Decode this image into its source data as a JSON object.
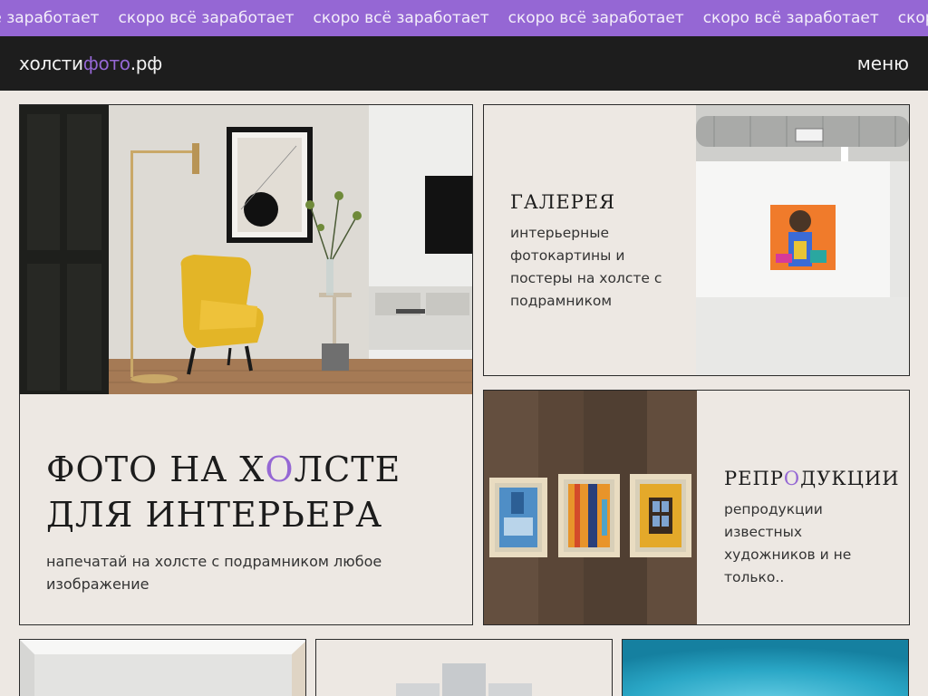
{
  "ticker": {
    "text": "скоро всё заработает",
    "first_fragment": "всё заработает"
  },
  "header": {
    "logo_part1": "холсти",
    "logo_part2": "фото",
    "logo_part3": ".рф",
    "menu_label": "меню"
  },
  "hero": {
    "title_line1_a": "ФОТО НА Х",
    "title_line1_o": "О",
    "title_line1_b": "ЛСТЕ",
    "title_line2": "ДЛЯ ИНТЕРЬЕРА",
    "subtitle": "напечатай на холсте с подрамником любое изображение"
  },
  "gallery": {
    "title": "ГАЛЕРЕЯ",
    "description": "интерьерные фотокартины и постеры на холсте с подрамником"
  },
  "repro": {
    "title_a": "РЕПР",
    "title_o": "О",
    "title_b": "ДУКЦИИ",
    "description": "репродукции известных художников и не только.."
  },
  "colors": {
    "accent": "#9567d4",
    "background": "#ede8e3",
    "header": "#1d1d1d"
  }
}
